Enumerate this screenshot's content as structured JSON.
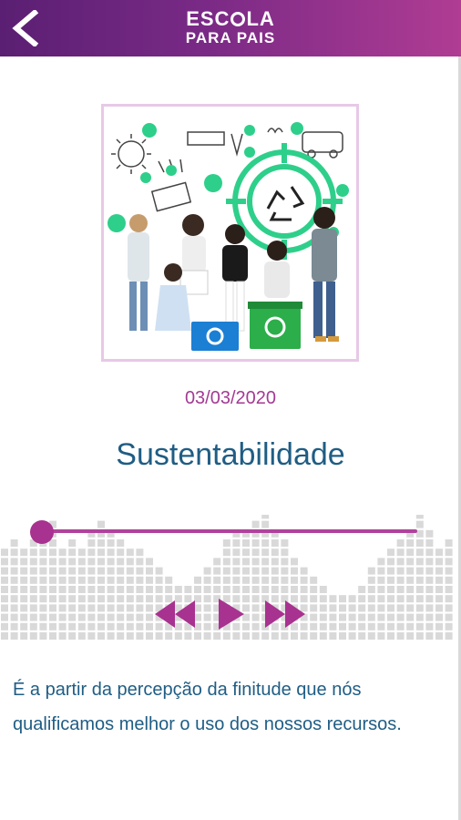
{
  "header": {
    "logo_line1_a": "ESC",
    "logo_line1_b": "LA",
    "logo_line2": "PARA PAIS",
    "back_icon": "chevron-left-icon"
  },
  "episode": {
    "date": "03/03/2020",
    "title": "Sustentabilidade",
    "progress": 0.0,
    "description": "É a partir da percepção da finitude que nós qualificamos melhor o uso dos nossos recursos."
  },
  "player": {
    "rewind_icon": "rewind-icon",
    "play_icon": "play-icon",
    "forward_icon": "fast-forward-icon"
  },
  "colors": {
    "header_start": "#5a1f72",
    "header_end": "#b03c93",
    "accent": "#a8328f",
    "title": "#1f5d84",
    "waveform": "#d9d9d9"
  }
}
